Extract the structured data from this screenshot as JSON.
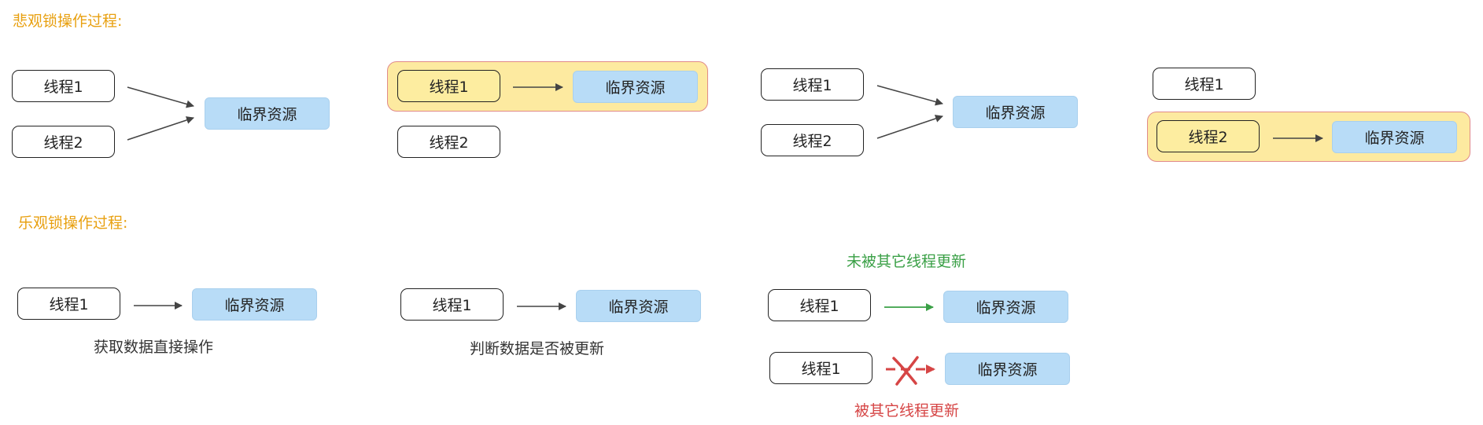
{
  "pessimistic": {
    "heading": "悲观锁操作过程:",
    "thread1": "线程1",
    "thread2": "线程2",
    "resource": "临界资源"
  },
  "optimistic": {
    "heading": "乐观锁操作过程:",
    "thread1": "线程1",
    "resource": "临界资源",
    "step1_caption": "获取数据直接操作",
    "step2_caption": "判断数据是否被更新",
    "not_updated_label": "未被其它线程更新",
    "updated_label": "被其它线程更新"
  },
  "colors": {
    "heading": "#e8a010",
    "resource_fill": "#b8dcf7",
    "active_thread_fill": "#fdeda0",
    "lock_frame_border": "#e08a8a",
    "success_green": "#3aa046",
    "fail_red": "#d64545"
  }
}
